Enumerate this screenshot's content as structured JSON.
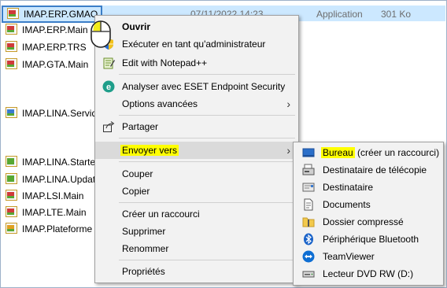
{
  "files": [
    {
      "name": "IMAP.ERP.GMAO",
      "date": "07/11/2022 14:23",
      "type": "Application",
      "size": "301 Ko",
      "selected": true
    },
    {
      "name": "IMAP.ERP.Main"
    },
    {
      "name": "IMAP.ERP.TRS"
    },
    {
      "name": "IMAP.GTA.Main"
    },
    {
      "name": "IMAP.LINA.Servid"
    },
    {
      "name": "IMAP.LINA.Starte"
    },
    {
      "name": "IMAP.LINA.Updat"
    },
    {
      "name": "IMAP.LSI.Main"
    },
    {
      "name": "IMAP.LTE.Main"
    },
    {
      "name": "IMAP.Plateforme"
    }
  ],
  "context_menu": {
    "open": "Ouvrir",
    "run_as_admin": "Exécuter en tant qu'administrateur",
    "edit_notepad": "Edit with Notepad++",
    "eset_scan": "Analyser avec ESET Endpoint Security",
    "advanced_options": "Options avancées",
    "share": "Partager",
    "send_to": "Envoyer vers",
    "cut": "Couper",
    "copy": "Copier",
    "create_shortcut": "Créer un raccourci",
    "delete": "Supprimer",
    "rename": "Renommer",
    "properties": "Propriétés"
  },
  "send_to_menu": {
    "desktop": "Bureau",
    "desktop_suffix": " (créer un raccourci)",
    "fax": "Destinataire de télécopie",
    "mail": "Destinataire",
    "documents": "Documents",
    "zip": "Dossier compressé",
    "bluetooth": "Périphérique Bluetooth",
    "teamviewer": "TeamViewer",
    "dvd": "Lecteur DVD RW (D:)"
  },
  "colors": {
    "highlight": "#ffff00",
    "selection": "#cce8ff",
    "eset": "#1f9e8a",
    "bluetooth": "#1a63c9",
    "teamviewer": "#0e6ed3"
  }
}
